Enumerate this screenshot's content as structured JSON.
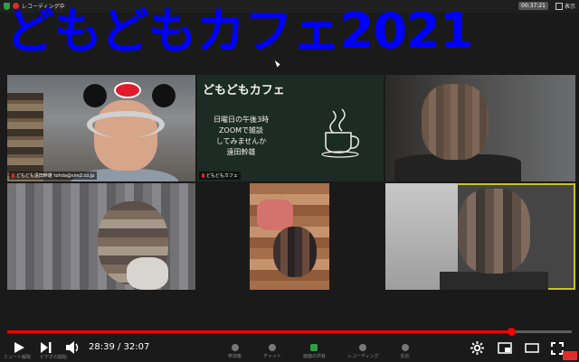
{
  "topbar": {
    "recording_label": "レコーディング中",
    "elapsed_time": "00:37:21",
    "view_label": "表示"
  },
  "overlay": {
    "title": "どもどもカフェ2021"
  },
  "tiles": [
    {
      "name": "どもども遠田幹雄 tohda@sim2.co.jp"
    },
    {
      "name": "どもどもカフェ"
    }
  ],
  "chalkboard": {
    "title": "どもどもカフェ",
    "lines": [
      "日曜日の午後3時",
      "ZOOMで雑談",
      "してみませんか",
      "遠田幹雄"
    ]
  },
  "player": {
    "current_time": "28:39",
    "separator": " / ",
    "duration": "32:07",
    "progress": 0.892,
    "mute_label": "ミュート解除",
    "video_label": "ビデオの開始"
  },
  "zoom_toolbar": {
    "items": [
      {
        "label": "参加者",
        "icon": "participants-icon"
      },
      {
        "label": "チャット",
        "icon": "chat-icon"
      },
      {
        "label": "画面の共有",
        "icon": "share-screen-icon"
      },
      {
        "label": "レコーディング",
        "icon": "record-icon"
      },
      {
        "label": "反応",
        "icon": "reaction-icon"
      }
    ]
  },
  "colors": {
    "title": "#0000ff",
    "progress": "#ff0000"
  }
}
